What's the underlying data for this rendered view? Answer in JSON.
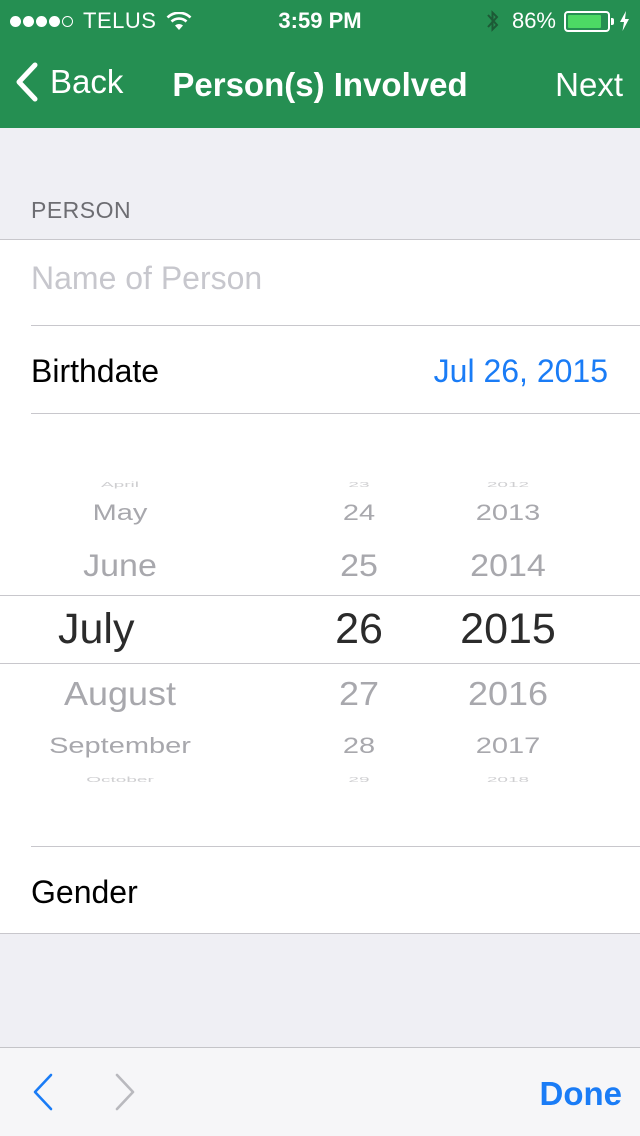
{
  "status": {
    "carrier": "TELUS",
    "time": "3:59 PM",
    "battery": "86%",
    "battery_level": 0.86
  },
  "nav": {
    "back": "Back",
    "title": "Person(s) Involved",
    "next": "Next"
  },
  "form": {
    "section_header": "PERSON",
    "name_placeholder": "Name of Person",
    "name_value": "",
    "birthdate_label": "Birthdate",
    "birthdate_value": "Jul 26, 2015",
    "gender_label": "Gender"
  },
  "picker": {
    "months": [
      "April",
      "May",
      "June",
      "July",
      "August",
      "September",
      "October"
    ],
    "days": [
      "23",
      "24",
      "25",
      "26",
      "27",
      "28",
      "29"
    ],
    "years": [
      "2012",
      "2013",
      "2014",
      "2015",
      "2016",
      "2017",
      "2018"
    ],
    "selected_index": 3
  },
  "toolbar": {
    "done": "Done"
  },
  "colors": {
    "nav_bg": "#258f52",
    "accent": "#1a7cf6",
    "battery_fill": "#4cd964"
  }
}
